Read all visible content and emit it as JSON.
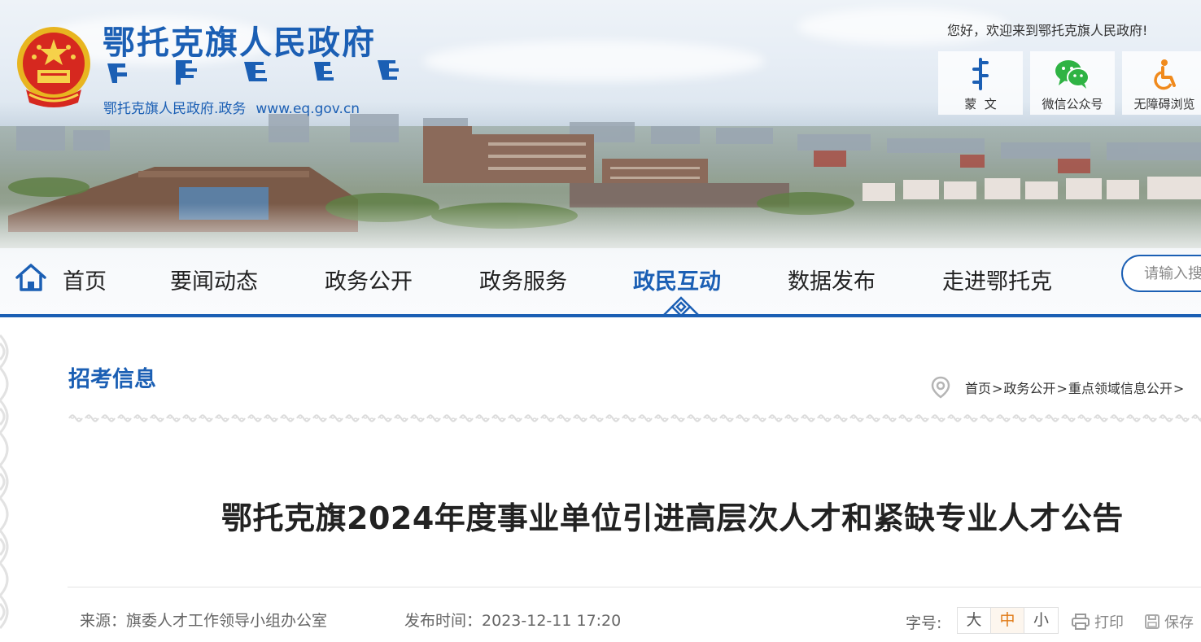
{
  "header": {
    "site_title": "鄂托克旗人民政府",
    "site_sub_label": "鄂托克旗人民政府.政务",
    "site_url": "www.eq.gov.cn",
    "welcome": "您好，欢迎来到鄂托克旗人民政府!",
    "quick_links": [
      {
        "label": "蒙  文",
        "icon": "mongolian-script-icon"
      },
      {
        "label": "微信公众号",
        "icon": "wechat-icon"
      },
      {
        "label": "无障碍浏览",
        "icon": "accessibility-icon"
      }
    ]
  },
  "nav": {
    "items": [
      {
        "label": "首页"
      },
      {
        "label": "要闻动态"
      },
      {
        "label": "政务公开"
      },
      {
        "label": "政务服务"
      },
      {
        "label": "政民互动",
        "active": true
      },
      {
        "label": "数据发布"
      },
      {
        "label": "走进鄂托克"
      }
    ],
    "search_placeholder": "请输入搜"
  },
  "content": {
    "section_title": "招考信息",
    "breadcrumb": [
      "首页",
      "政务公开",
      "重点领域信息公开"
    ],
    "breadcrumb_sep": ">",
    "article_title": "鄂托克旗2024年度事业单位引进高层次人才和紧缺专业人才公告",
    "source_label": "来源：",
    "source": "旗委人才工作领导小组办公室",
    "date_label": "发布时间：",
    "date": "2023-12-11 17:20",
    "fontsize_label": "字号:",
    "fontsize_options": [
      "大",
      "中",
      "小"
    ],
    "fontsize_selected": "中",
    "print_label": "打印",
    "save_label": "保存"
  },
  "colors": {
    "brand_blue": "#1b5fb4",
    "active_orange": "#e07a16"
  }
}
